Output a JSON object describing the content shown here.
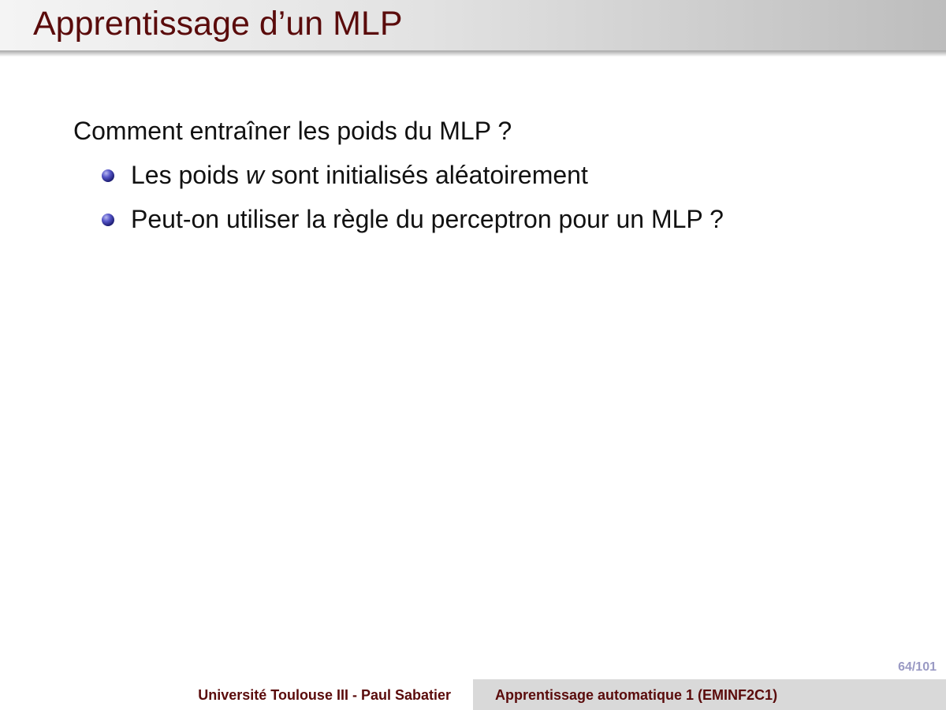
{
  "slide": {
    "title": "Apprentissage d’un MLP",
    "intro": "Comment entraîner les poids du MLP ?",
    "bullets": [
      {
        "before": "Les poids ",
        "emphasis": "w",
        "after": " sont initialisés aléatoirement"
      },
      {
        "before": "Peut-on utiliser la règle du perceptron pour un MLP ?",
        "emphasis": "",
        "after": ""
      }
    ],
    "page_number": "64/101"
  },
  "footer": {
    "institution": "Université Toulouse III - Paul Sabatier",
    "course": "Apprentissage automatique 1 (EMINF2C1)"
  },
  "colors": {
    "title": "#5a0b0b",
    "bullet": "#2b2b8f",
    "page_number": "#9a9ac4",
    "footer_right_bg": "#d9d9d9"
  },
  "icons": {
    "bullet": "sphere-bullet-icon"
  }
}
